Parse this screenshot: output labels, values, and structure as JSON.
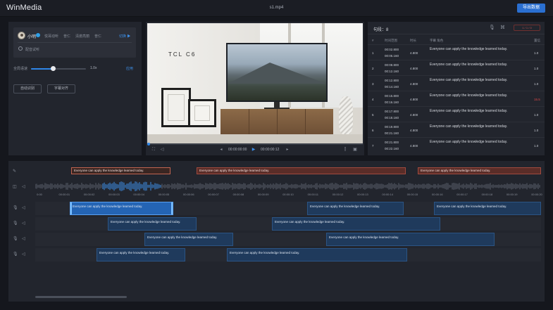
{
  "app": {
    "logo": "WinMedia",
    "filename": "s1.mp4",
    "export_label": "导出数据"
  },
  "voice_panel": {
    "voice_name": "小明",
    "tags": [
      "悦耳动听",
      "普仁",
      "清澈亮丽",
      "普仁"
    ],
    "switch_label": "切换 ▶",
    "radio_label": "配音试听",
    "speed_label": "全局语速",
    "speed_value": "1.0x",
    "speed_fraction": 0.4,
    "apply_label": "应用",
    "button_one": "自动识别",
    "button_two": "字幕对齐"
  },
  "video": {
    "tv_brand": "TCL C6",
    "current_time": "00:00:00:00",
    "total_time": "00:00:00:12",
    "progress_fraction": 0.0
  },
  "subtitles": {
    "count_label": "句段：8",
    "pill_label": "1 / 1 / 0",
    "headers": [
      "#",
      "时间范围",
      "时长",
      "字幕  角色",
      "置信"
    ],
    "rows": [
      {
        "n": "1",
        "start": "00:02.800",
        "end": "00:05.160",
        "dur": "4.800",
        "text": "Everyone can apply the knowledge learned today.",
        "conf": "1.0",
        "bad": false
      },
      {
        "n": "2",
        "start": "00:08.800",
        "end": "00:12.160",
        "dur": "4.800",
        "text": "Everyone can apply the knowledge learned today.",
        "conf": "1.0",
        "bad": false
      },
      {
        "n": "3",
        "start": "00:12.800",
        "end": "00:14.160",
        "dur": "4.800",
        "text": "Everyone can apply the knowledge learned today.",
        "conf": "1.0",
        "bad": false
      },
      {
        "n": "4",
        "start": "00:15.800",
        "end": "00:16.160",
        "dur": "4.800",
        "text": "Everyone can apply the knowledge learned today.",
        "conf": "15.5",
        "bad": true
      },
      {
        "n": "5",
        "start": "00:17.800",
        "end": "00:18.160",
        "dur": "4.800",
        "text": "Everyone can apply the knowledge learned today.",
        "conf": "1.0",
        "bad": false
      },
      {
        "n": "6",
        "start": "00:19.800",
        "end": "00:21.160",
        "dur": "4.800",
        "text": "Everyone can apply the knowledge learned today.",
        "conf": "1.0",
        "bad": false
      },
      {
        "n": "7",
        "start": "00:21.800",
        "end": "00:22.160",
        "dur": "4.800",
        "text": "Everyone can apply the knowledge learned today.",
        "conf": "1.0",
        "bad": false
      }
    ]
  },
  "timeline": {
    "ticks": [
      "0:00",
      "00:00:01",
      "00:00:02",
      "00:00:03",
      "00:00:04",
      "00:00:05",
      "00:00:06",
      "00:00:07",
      "00:00:08",
      "00:00:09",
      "00:00:10",
      "00:00:11",
      "00:00:12",
      "00:00:13",
      "00:00:14",
      "00:00:15",
      "00:00:16",
      "00:00:17",
      "00:00:18",
      "00:00:19",
      "00:00:20"
    ],
    "original_clips": [
      {
        "text": "Everyone can apply the knowledge learned today.",
        "first": true
      },
      {
        "text": "Everyone can apply the knowledge learned today.",
        "first": false
      },
      {
        "text": "Everyone can apply the knowledge learned today.",
        "first": false
      }
    ],
    "track1": [
      "Everyone can apply the knowledge learned today.",
      "Everyone can apply the knowledge learned today.",
      "Everyone can apply the knowledge learned today."
    ],
    "track2": [
      "Everyone can apply the knowledge learned today.",
      "Everyone can apply the knowledge learned today."
    ],
    "track3": [
      "Everyone can apply the knowledge learned today.",
      "Everyone can apply the knowledge learned today."
    ],
    "track4": [
      "Everyone can apply the knowledge learned today.",
      "Everyone can apply the knowledge learned today."
    ]
  }
}
